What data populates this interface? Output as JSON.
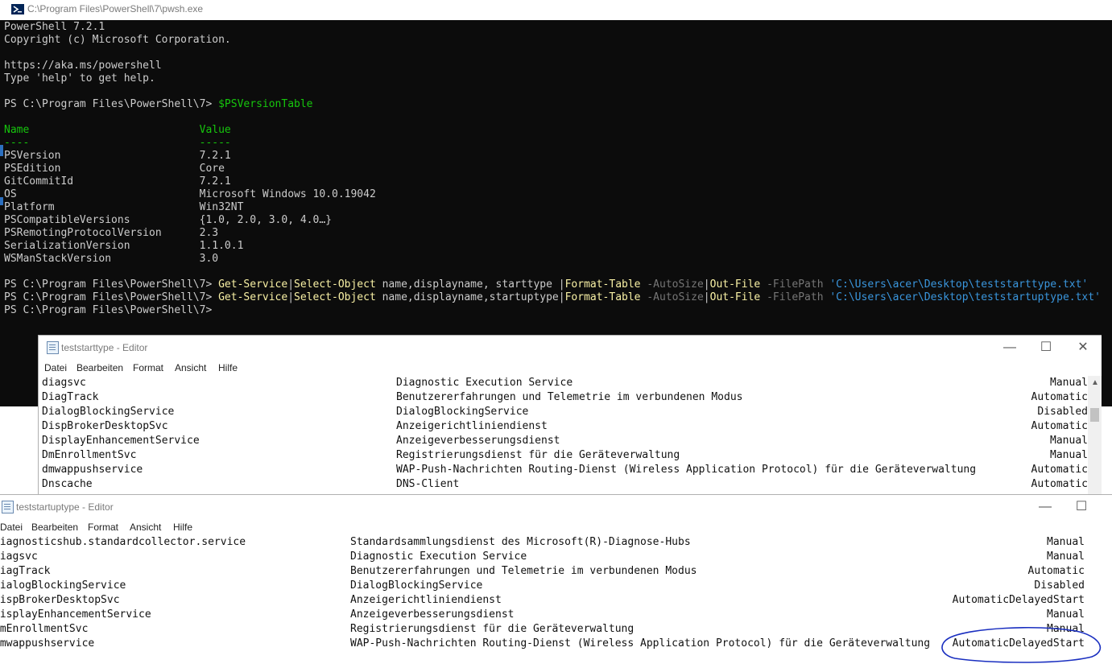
{
  "terminal": {
    "title": "C:\\Program Files\\PowerShell\\7\\pwsh.exe",
    "lines": [
      [
        {
          "t": "PowerShell 7.2.1",
          "c": "white"
        }
      ],
      [
        {
          "t": "Copyright (c) Microsoft Corporation.",
          "c": "white"
        }
      ],
      [],
      [
        {
          "t": "https://aka.ms/powershell",
          "c": "white"
        }
      ],
      [
        {
          "t": "Type 'help' to get help.",
          "c": "white"
        }
      ],
      [],
      [
        {
          "t": "PS C:\\Program Files\\PowerShell\\7> ",
          "c": "white"
        },
        {
          "t": "$PSVersionTable",
          "c": "green"
        }
      ],
      [],
      [
        {
          "t": "Name                           Value",
          "c": "green"
        }
      ],
      [
        {
          "t": "----                           -----",
          "c": "green"
        }
      ],
      [
        {
          "t": "PSVersion                      7.2.1",
          "c": "white"
        }
      ],
      [
        {
          "t": "PSEdition                      Core",
          "c": "white"
        }
      ],
      [
        {
          "t": "GitCommitId                    7.2.1",
          "c": "white"
        }
      ],
      [
        {
          "t": "OS                             Microsoft Windows 10.0.19042",
          "c": "white"
        }
      ],
      [
        {
          "t": "Platform                       Win32NT",
          "c": "white"
        }
      ],
      [
        {
          "t": "PSCompatibleVersions           {1.0, 2.0, 3.0, 4.0…}",
          "c": "white"
        }
      ],
      [
        {
          "t": "PSRemotingProtocolVersion      2.3",
          "c": "white"
        }
      ],
      [
        {
          "t": "SerializationVersion           1.1.0.1",
          "c": "white"
        }
      ],
      [
        {
          "t": "WSManStackVersion              3.0",
          "c": "white"
        }
      ],
      [],
      [
        {
          "t": "PS C:\\Program Files\\PowerShell\\7> ",
          "c": "white"
        },
        {
          "t": "Get-Service",
          "c": "yellow"
        },
        {
          "t": "|",
          "c": "white"
        },
        {
          "t": "Select-Object",
          "c": "yellow"
        },
        {
          "t": " name,displayname, starttype ",
          "c": "white"
        },
        {
          "t": "|",
          "c": "white"
        },
        {
          "t": "Format-Table",
          "c": "yellow"
        },
        {
          "t": " -AutoSize",
          "c": "gray"
        },
        {
          "t": "|",
          "c": "white"
        },
        {
          "t": "Out-File",
          "c": "yellow"
        },
        {
          "t": " -FilePath",
          "c": "gray"
        },
        {
          "t": " 'C:\\Users\\acer\\Desktop\\teststarttype.txt'",
          "c": "cyan"
        }
      ],
      [
        {
          "t": "PS C:\\Program Files\\PowerShell\\7> ",
          "c": "white"
        },
        {
          "t": "Get-Service",
          "c": "yellow"
        },
        {
          "t": "|",
          "c": "white"
        },
        {
          "t": "Select-Object",
          "c": "yellow"
        },
        {
          "t": " name,displayname,startuptype",
          "c": "white"
        },
        {
          "t": "|",
          "c": "white"
        },
        {
          "t": "Format-Table",
          "c": "yellow"
        },
        {
          "t": " -AutoSize",
          "c": "gray"
        },
        {
          "t": "|",
          "c": "white"
        },
        {
          "t": "Out-File",
          "c": "yellow"
        },
        {
          "t": " -FilePath",
          "c": "gray"
        },
        {
          "t": " 'C:\\Users\\acer\\Desktop\\teststartuptype.txt'",
          "c": "cyan"
        }
      ],
      [
        {
          "t": "PS C:\\Program Files\\PowerShell\\7>",
          "c": "white"
        }
      ]
    ]
  },
  "editor1": {
    "title": "teststarttype - Editor",
    "menu": [
      "Datei",
      "Bearbeiten",
      "Format",
      "Ansicht",
      "Hilfe"
    ],
    "controls": {
      "minimize": "—",
      "maximize": "☐",
      "close": "✕"
    },
    "rows": [
      {
        "name": "diagsvc",
        "display": "Diagnostic Execution Service",
        "start": "Manual"
      },
      {
        "name": "DiagTrack",
        "display": "Benutzererfahrungen und Telemetrie im verbundenen Modus",
        "start": "Automatic"
      },
      {
        "name": "DialogBlockingService",
        "display": "DialogBlockingService",
        "start": "Disabled"
      },
      {
        "name": "DispBrokerDesktopSvc",
        "display": "Anzeigerichtliniendienst",
        "start": "Automatic"
      },
      {
        "name": "DisplayEnhancementService",
        "display": "Anzeigeverbesserungsdienst",
        "start": "Manual"
      },
      {
        "name": "DmEnrollmentSvc",
        "display": "Registrierungsdienst für die Geräteverwaltung",
        "start": "Manual"
      },
      {
        "name": "dmwappushservice",
        "display": "WAP-Push-Nachrichten Routing-Dienst (Wireless Application Protocol) für die Geräteverwaltung",
        "start": "Automatic"
      },
      {
        "name": "Dnscache",
        "display": "DNS-Client",
        "start": "Automatic"
      }
    ]
  },
  "editor2": {
    "title": "teststartuptype - Editor",
    "menu": [
      "Datei",
      "Bearbeiten",
      "Format",
      "Ansicht",
      "Hilfe"
    ],
    "controls": {
      "minimize": "—",
      "maximize": "☐"
    },
    "rows": [
      {
        "name": "diagnosticshub.standardcollector.service",
        "display": "Standardsammlungsdienst des Microsoft(R)-Diagnose-Hubs",
        "start": "Manual"
      },
      {
        "name": "diagsvc",
        "display": "Diagnostic Execution Service",
        "start": "Manual"
      },
      {
        "name": "DiagTrack",
        "display": "Benutzererfahrungen und Telemetrie im verbundenen Modus",
        "start": "Automatic"
      },
      {
        "name": "DialogBlockingService",
        "display": "DialogBlockingService",
        "start": "Disabled"
      },
      {
        "name": "DispBrokerDesktopSvc",
        "display": "Anzeigerichtliniendienst",
        "start": "AutomaticDelayedStart"
      },
      {
        "name": "DisplayEnhancementService",
        "display": "Anzeigeverbesserungsdienst",
        "start": "Manual"
      },
      {
        "name": "DmEnrollmentSvc",
        "display": "Registrierungsdienst für die Geräteverwaltung",
        "start": "Manual"
      },
      {
        "name": "dmwappushservice",
        "display": "WAP-Push-Nachrichten Routing-Dienst (Wireless Application Protocol) für die Geräteverwaltung",
        "start": "AutomaticDelayedStart"
      }
    ]
  },
  "colors": {
    "terminal_bg": "#0c0c0c",
    "white": "#cccccc",
    "yellow": "#f9f1a5",
    "green": "#16c60c",
    "gray": "#767676",
    "cyan": "#3a96dd",
    "annotation": "#1a2fc0"
  },
  "icons": {
    "terminal": "powershell-icon",
    "editor": "notepad-icon",
    "annotation": "hand-drawn-ellipse"
  }
}
